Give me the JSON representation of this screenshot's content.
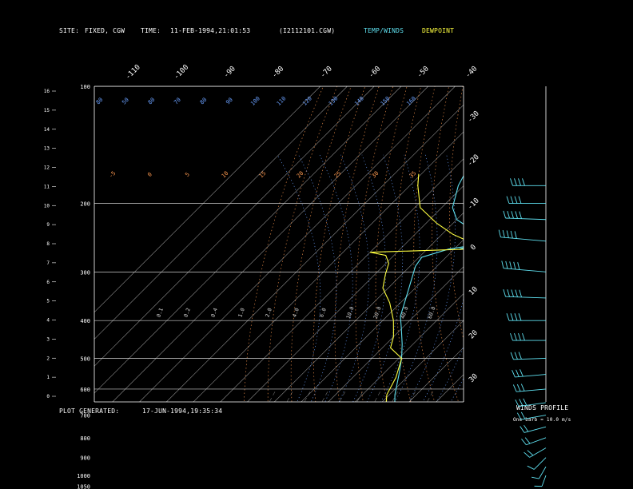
{
  "header": {
    "site_label": "SITE:",
    "site_value": "FIXED, CGW",
    "time_label": "TIME:",
    "time_value": "11-FEB-1994,21:01:53",
    "file_id": "(I2112101.CGW)",
    "legend_temp": "TEMP/WINDS",
    "legend_dew": "DEWPOINT"
  },
  "footer": {
    "generated_label": "PLOT GENERATED:",
    "generated_value": "17-JUN-1994,19:35:34"
  },
  "winds_panel": {
    "title": "WINDS PROFILE",
    "barb_note": "One barb = 10.0 m/s"
  },
  "colors": {
    "temp": "#5fe0f0",
    "dewpoint": "#ffff40",
    "isotherm": "#c8c8c8",
    "dry_adiabat": "#ff9a50",
    "moist_adiabat": "#6aa0ff",
    "mixing_ratio": "#bfbfbf"
  },
  "chart_data": {
    "type": "line",
    "subtype": "skew-t log-p",
    "y_pressure_labels": [
      "100",
      "200",
      "300",
      "400",
      "500",
      "600",
      "700",
      "800",
      "900",
      "1000",
      "1050"
    ],
    "y_pressure_values": [
      100,
      200,
      300,
      400,
      500,
      600,
      700,
      800,
      900,
      1000,
      1050
    ],
    "y_height_km_labels": [
      "16",
      "15",
      "14",
      "13",
      "12",
      "11",
      "10",
      "9",
      "8",
      "7",
      "6",
      "5",
      "4",
      "3",
      "2",
      "1",
      "0"
    ],
    "isotherm_top_labels": [
      "-110",
      "-100",
      "-90",
      "-80",
      "-70",
      "-60",
      "-50",
      "-40"
    ],
    "isotherm_right_labels": [
      "-30",
      "-20",
      "-10",
      "0",
      "10",
      "20",
      "30"
    ],
    "moist_adiabat_labels": [
      "80",
      "50",
      "80",
      "70",
      "80",
      "90",
      "100",
      "110",
      "120",
      "130",
      "140",
      "150",
      "160"
    ],
    "dry_adiabat_labels": [
      "-5",
      "0",
      "5",
      "10",
      "15",
      "20",
      "25",
      "30",
      "35"
    ],
    "mixing_ratio_labels": [
      "0.1",
      "0.2",
      "0.4",
      "1.0",
      "2.0",
      "4.0",
      "6.0",
      "10.0",
      "20.0",
      "40.0",
      "60.0"
    ],
    "series": [
      {
        "name": "TEMP/WINDS",
        "points": [
          {
            "p": 1025,
            "t": 4.0
          },
          {
            "p": 1000,
            "t": 5.0
          },
          {
            "p": 970,
            "t": 7.0
          },
          {
            "p": 940,
            "t": 9.6
          },
          {
            "p": 910,
            "t": 10.8
          },
          {
            "p": 850,
            "t": 9.0
          },
          {
            "p": 780,
            "t": 6.0
          },
          {
            "p": 700,
            "t": -0.5
          },
          {
            "p": 620,
            "t": -8.0
          },
          {
            "p": 550,
            "t": -14.0
          },
          {
            "p": 500,
            "t": -19.0
          },
          {
            "p": 460,
            "t": -24.0
          },
          {
            "p": 420,
            "t": -30.0
          },
          {
            "p": 390,
            "t": -35.0
          },
          {
            "p": 340,
            "t": -41.0
          },
          {
            "p": 290,
            "t": -48.0
          },
          {
            "p": 275,
            "t": -49.0
          },
          {
            "p": 262,
            "t": -42.0
          },
          {
            "p": 255,
            "t": -33.0
          },
          {
            "p": 262,
            "t": -38.0
          },
          {
            "p": 256,
            "t": -35.0
          },
          {
            "p": 240,
            "t": -39.0
          },
          {
            "p": 230,
            "t": -43.0
          },
          {
            "p": 220,
            "t": -50.0
          },
          {
            "p": 205,
            "t": -56.0
          },
          {
            "p": 180,
            "t": -62.0
          },
          {
            "p": 168,
            "t": -64.0
          }
        ]
      },
      {
        "name": "DEWPOINT",
        "points": [
          {
            "p": 1025,
            "t": 2.5
          },
          {
            "p": 1000,
            "t": 0.5
          },
          {
            "p": 970,
            "t": -3.0
          },
          {
            "p": 940,
            "t": 6.0
          },
          {
            "p": 910,
            "t": 8.0
          },
          {
            "p": 880,
            "t": 7.0
          },
          {
            "p": 780,
            "t": 2.0
          },
          {
            "p": 700,
            "t": -4.0
          },
          {
            "p": 620,
            "t": -11.0
          },
          {
            "p": 560,
            "t": -14.0
          },
          {
            "p": 500,
            "t": -19.0
          },
          {
            "p": 470,
            "t": -27.0
          },
          {
            "p": 440,
            "t": -30.0
          },
          {
            "p": 400,
            "t": -36.0
          },
          {
            "p": 360,
            "t": -44.0
          },
          {
            "p": 330,
            "t": -52.0
          },
          {
            "p": 305,
            "t": -56.0
          },
          {
            "p": 285,
            "t": -59.0
          },
          {
            "p": 272,
            "t": -63.0
          },
          {
            "p": 267,
            "t": -70.0
          },
          {
            "p": 262,
            "t": -34.0
          },
          {
            "p": 256,
            "t": -33.0
          },
          {
            "p": 240,
            "t": -46.0
          },
          {
            "p": 225,
            "t": -56.0
          },
          {
            "p": 205,
            "t": -68.0
          },
          {
            "p": 180,
            "t": -77.0
          },
          {
            "p": 168,
            "t": -81.0
          }
        ]
      }
    ],
    "winds": [
      {
        "p": 1000,
        "dir": 200,
        "spd": 5
      },
      {
        "p": 950,
        "dir": 210,
        "spd": 8
      },
      {
        "p": 900,
        "dir": 225,
        "spd": 12
      },
      {
        "p": 850,
        "dir": 240,
        "spd": 15
      },
      {
        "p": 800,
        "dir": 250,
        "spd": 18
      },
      {
        "p": 750,
        "dir": 255,
        "spd": 20
      },
      {
        "p": 700,
        "dir": 260,
        "spd": 24
      },
      {
        "p": 650,
        "dir": 262,
        "spd": 27
      },
      {
        "p": 600,
        "dir": 265,
        "spd": 30
      },
      {
        "p": 550,
        "dir": 265,
        "spd": 32
      },
      {
        "p": 500,
        "dir": 268,
        "spd": 34
      },
      {
        "p": 450,
        "dir": 270,
        "spd": 35
      },
      {
        "p": 400,
        "dir": 270,
        "spd": 40
      },
      {
        "p": 350,
        "dir": 272,
        "spd": 45
      },
      {
        "p": 300,
        "dir": 275,
        "spd": 48
      },
      {
        "p": 250,
        "dir": 275,
        "spd": 52
      },
      {
        "p": 220,
        "dir": 272,
        "spd": 45
      },
      {
        "p": 200,
        "dir": 270,
        "spd": 40
      },
      {
        "p": 180,
        "dir": 270,
        "spd": 35
      }
    ]
  }
}
